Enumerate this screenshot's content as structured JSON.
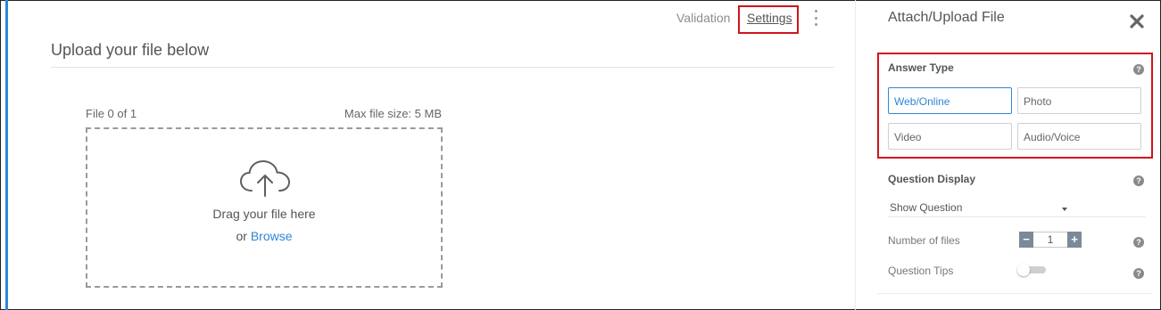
{
  "header": {
    "tabs": [
      {
        "label": "Validation",
        "active": false
      },
      {
        "label": "Settings",
        "active": true
      }
    ]
  },
  "main": {
    "title": "Upload your file below",
    "file_count": "File 0 of 1",
    "max_size": "Max file size: 5 MB",
    "drag_text": "Drag your file here",
    "or_text": "or",
    "browse_label": "Browse"
  },
  "panel": {
    "title": "Attach/Upload File",
    "answer_type": {
      "label": "Answer Type",
      "options": [
        {
          "label": "Web/Online",
          "selected": true
        },
        {
          "label": "Photo",
          "selected": false
        },
        {
          "label": "Video",
          "selected": false
        },
        {
          "label": "Audio/Voice",
          "selected": false
        }
      ]
    },
    "question_display": {
      "label": "Question Display",
      "selected": "Show Question"
    },
    "number_of_files": {
      "label": "Number of files",
      "value": "1",
      "minus": "−",
      "plus": "+"
    },
    "question_tips": {
      "label": "Question Tips",
      "enabled": false
    },
    "help_glyph": "?"
  },
  "colors": {
    "accent": "#2f86d6",
    "highlight": "#d0141c"
  }
}
